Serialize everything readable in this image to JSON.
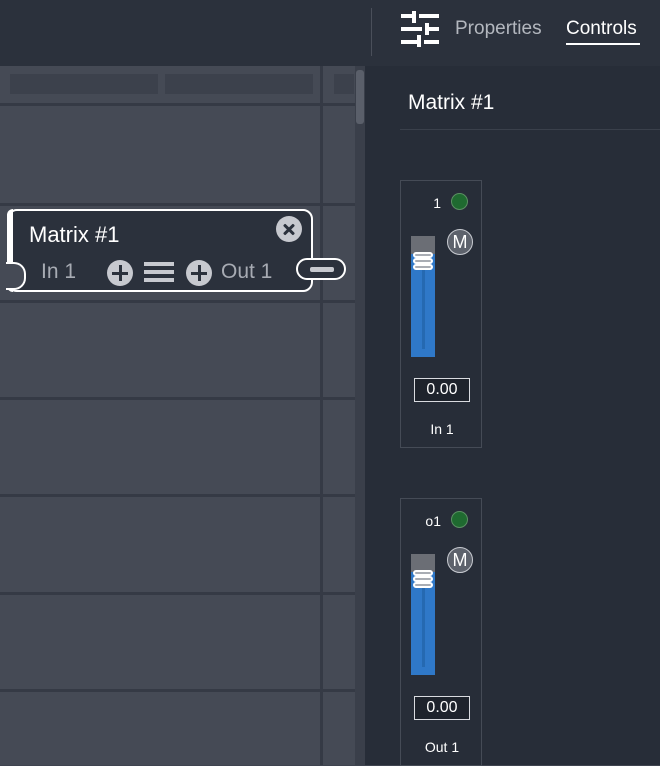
{
  "canvas": {
    "node": {
      "title": "Matrix #1",
      "input_label": "In 1",
      "output_label": "Out 1",
      "close_icon": "close-circle-icon",
      "menu_icon": "hamburger-icon",
      "add_input_icon": "plus-circle-icon",
      "add_output_icon": "plus-circle-icon",
      "accent_color": "#ffffff"
    }
  },
  "panel": {
    "header_icon": "sliders-icon",
    "tabs": [
      {
        "label": "Properties",
        "active": false
      },
      {
        "label": "Controls",
        "active": true
      }
    ],
    "title": "Matrix #1",
    "strips": [
      {
        "number": "1",
        "led_color": "#1f6a30",
        "mute_label": "M",
        "value": "0.00",
        "name": "In 1",
        "fader_level": 0.85
      },
      {
        "number": "o1",
        "led_color": "#1f6a30",
        "mute_label": "M",
        "value": "0.00",
        "name": "Out 1",
        "fader_level": 0.85
      }
    ]
  },
  "colors": {
    "fader_fill": "#2f78c8",
    "panel_bg": "#272d38",
    "canvas_bg": "#454a55"
  }
}
